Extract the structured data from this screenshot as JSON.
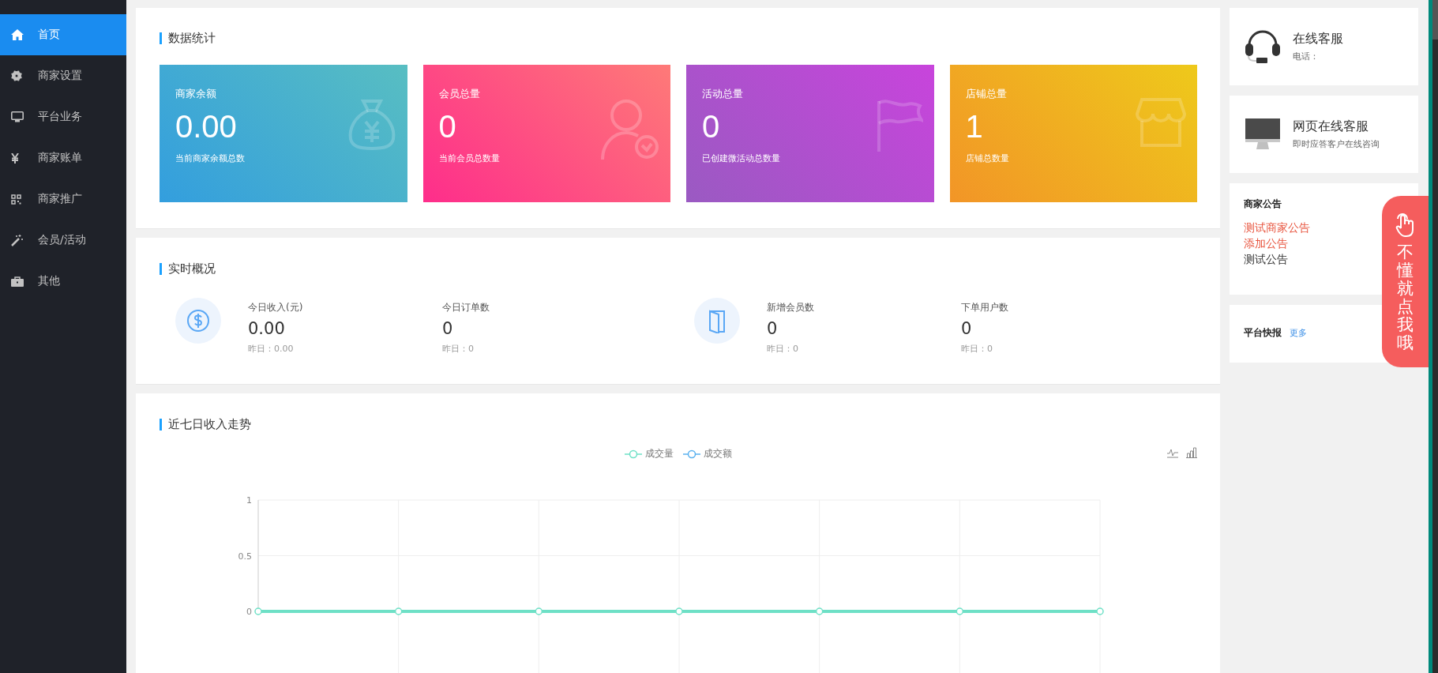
{
  "sidebar": {
    "items": [
      {
        "label": "首页",
        "selected": true
      },
      {
        "label": "商家设置",
        "selected": false
      },
      {
        "label": "平台业务",
        "selected": false
      },
      {
        "label": "商家账单",
        "selected": false
      },
      {
        "label": "商家推广",
        "selected": false
      },
      {
        "label": "会员/活动",
        "selected": false
      },
      {
        "label": "其他",
        "selected": false
      }
    ]
  },
  "stats": {
    "title": "数据统计",
    "cards": [
      {
        "label": "商家余额",
        "value": "0.00",
        "note": "当前商家余额总数"
      },
      {
        "label": "会员总量",
        "value": "0",
        "note": "当前会员总数量"
      },
      {
        "label": "活动总量",
        "value": "0",
        "note": "已创建微活动总数量"
      },
      {
        "label": "店铺总量",
        "value": "1",
        "note": "店铺总数量"
      }
    ]
  },
  "overview": {
    "title": "实时概况",
    "groups": [
      {
        "metrics": [
          {
            "label": "今日收入(元)",
            "value": "0.00",
            "yesterday": "昨日：0.00"
          },
          {
            "label": "今日订单数",
            "value": "0",
            "yesterday": "昨日：0"
          }
        ]
      },
      {
        "metrics": [
          {
            "label": "新增会员数",
            "value": "0",
            "yesterday": "昨日：0"
          },
          {
            "label": "下单用户数",
            "value": "0",
            "yesterday": "昨日：0"
          }
        ]
      }
    ]
  },
  "trend": {
    "title": "近七日收入走势",
    "chart_data": {
      "type": "line",
      "ylim": [
        0,
        1
      ],
      "yticks": [
        0,
        0.5,
        1
      ],
      "grid": true,
      "series": [
        {
          "name": "成交量",
          "color": "#6ee0c6",
          "marker": "circle",
          "values": [
            0,
            0,
            0,
            0,
            0,
            0,
            0
          ]
        },
        {
          "name": "成交额",
          "color": "#5ab1ef",
          "marker": "circle",
          "values": [
            null,
            null,
            null,
            null,
            null,
            null,
            null
          ]
        }
      ]
    }
  },
  "service": {
    "cards": [
      {
        "title": "在线客服",
        "subtitle": "电话："
      },
      {
        "title": "网页在线客服",
        "subtitle": "即时应答客户在线咨询"
      }
    ]
  },
  "notices": {
    "title": "商家公告",
    "items": [
      {
        "text": "测试商家公告",
        "color": "#e8553f"
      },
      {
        "text": "添加公告",
        "color": "#e8553f"
      },
      {
        "text": "测试公告",
        "color": "#333333"
      }
    ]
  },
  "news": {
    "title": "平台快报",
    "more": "更多"
  },
  "help_button": {
    "label": "不懂就点我哦"
  }
}
